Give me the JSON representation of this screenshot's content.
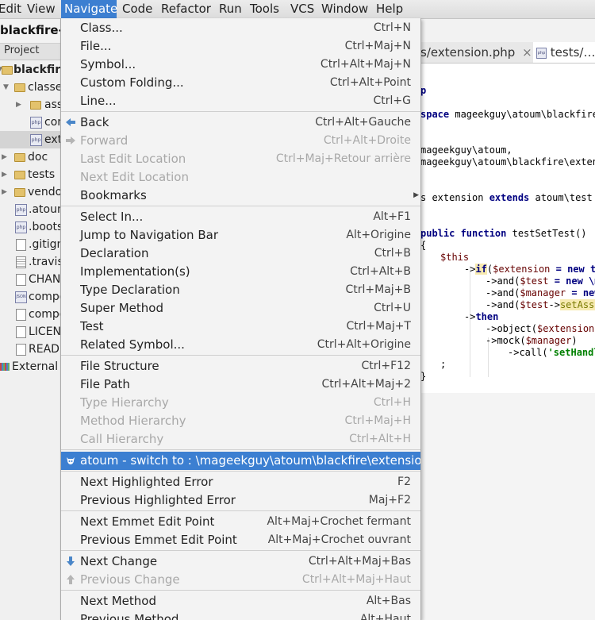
{
  "menubar": [
    "Edit",
    "View",
    "Navigate",
    "Code",
    "Refactor",
    "Run",
    "Tools",
    "VCS",
    "Window",
    "Help"
  ],
  "project_title": "blackfire-extension",
  "panel_header": "Project",
  "tree": [
    {
      "label": "blackfire",
      "icon": "folder-icon"
    },
    {
      "label": "classes",
      "icon": "folder-icon"
    },
    {
      "label": "assets",
      "icon": "folder-icon"
    },
    {
      "label": "configuration",
      "icon": "php-file-icon"
    },
    {
      "label": "extension",
      "icon": "php-file-icon"
    },
    {
      "label": "doc",
      "icon": "folder-icon"
    },
    {
      "label": "tests",
      "icon": "folder-icon"
    },
    {
      "label": "vendor",
      "icon": "folder-icon"
    },
    {
      "label": ".atoum",
      "icon": "php-file-icon"
    },
    {
      "label": ".bootstrap",
      "icon": "php-file-icon"
    },
    {
      "label": ".gitignore",
      "icon": "file-icon"
    },
    {
      "label": ".travis",
      "icon": "config-file-icon"
    },
    {
      "label": "CHANGELOG",
      "icon": "file-icon"
    },
    {
      "label": "composer",
      "icon": "json-file-icon"
    },
    {
      "label": "composer",
      "icon": "file-icon"
    },
    {
      "label": "LICENSE",
      "icon": "file-icon"
    },
    {
      "label": "README",
      "icon": "file-icon"
    },
    {
      "label": "External Libraries",
      "icon": "libraries-icon"
    }
  ],
  "tabs": [
    {
      "label": "s/extension.php",
      "close": "×"
    },
    {
      "label": "tests/…/"
    }
  ],
  "code": {
    "l1": "p",
    "l2a": "space ",
    "l2b": "mageekguy\\atoum\\blackfire\\",
    "l3": "mageekguy\\atoum,",
    "l4": "mageekguy\\atoum\\blackfire\\extens",
    "l5a": "s extension ",
    "l5b": "extends ",
    "l5c": "atoum\\test",
    "l6a": "public function ",
    "l6b": "testSetTest()",
    "l7": "{",
    "l8": "$this",
    "l9a": "->",
    "l9b": "if",
    "l9c": "(",
    "l9d": "$extension",
    " l9e": "",
    "l9f": " = new te",
    "l10a": "->and(",
    "l10b": "$test",
    " l10c": "",
    "l10d": " = new \\m",
    "l11a": "->and(",
    "l11b": "$manager",
    "l11c": " = new",
    "l12a": "->and(",
    "l12b": "$test",
    "l12c": "->",
    "l12d": "setAsse",
    "l13a": "->",
    "l13b": "then",
    "l14a": "->object(",
    "l14b": "$extension",
    "l14c": "-",
    "l15a": "->mock(",
    "l15b": "$manager",
    "l15c": ")",
    "l16a": "->call(",
    "l16b": "'setHandl",
    "l17": ";",
    "l18": "}"
  },
  "menu": [
    {
      "label": "Class...",
      "shortcut": "Ctrl+N"
    },
    {
      "label": "File...",
      "shortcut": "Ctrl+Maj+N"
    },
    {
      "label": "Symbol...",
      "shortcut": "Ctrl+Alt+Maj+N"
    },
    {
      "label": "Custom Folding...",
      "shortcut": "Ctrl+Alt+Point"
    },
    {
      "label": "Line...",
      "shortcut": "Ctrl+G"
    },
    {
      "label": "Back",
      "shortcut": "Ctrl+Alt+Gauche",
      "icon": "back-arrow-icon"
    },
    {
      "label": "Forward",
      "shortcut": "Ctrl+Alt+Droite",
      "icon": "forward-arrow-icon",
      "disabled": true
    },
    {
      "label": "Last Edit Location",
      "shortcut": "Ctrl+Maj+Retour arrière",
      "disabled": true
    },
    {
      "label": "Next Edit Location",
      "shortcut": "",
      "disabled": true
    },
    {
      "label": "Bookmarks",
      "shortcut": "",
      "submenu": true
    },
    {
      "label": "Select In...",
      "shortcut": "Alt+F1"
    },
    {
      "label": "Jump to Navigation Bar",
      "shortcut": "Alt+Origine"
    },
    {
      "label": "Declaration",
      "shortcut": "Ctrl+B"
    },
    {
      "label": "Implementation(s)",
      "shortcut": "Ctrl+Alt+B"
    },
    {
      "label": "Type Declaration",
      "shortcut": "Ctrl+Maj+B"
    },
    {
      "label": "Super Method",
      "shortcut": "Ctrl+U"
    },
    {
      "label": "Test",
      "shortcut": "Ctrl+Maj+T"
    },
    {
      "label": "Related Symbol...",
      "shortcut": "Ctrl+Alt+Origine"
    },
    {
      "label": "File Structure",
      "shortcut": "Ctrl+F12"
    },
    {
      "label": "File Path",
      "shortcut": "Ctrl+Alt+Maj+2"
    },
    {
      "label": "Type Hierarchy",
      "shortcut": "Ctrl+H",
      "disabled": true
    },
    {
      "label": "Method Hierarchy",
      "shortcut": "Ctrl+Maj+H",
      "disabled": true
    },
    {
      "label": "Call Hierarchy",
      "shortcut": "Ctrl+Alt+H",
      "disabled": true
    },
    {
      "label": "atoum - switch to : \\mageekguy\\atoum\\blackfire\\extension",
      "shortcut": "",
      "icon": "atoum-icon",
      "highlighted": true
    },
    {
      "label": "Next Highlighted Error",
      "shortcut": "F2"
    },
    {
      "label": "Previous Highlighted Error",
      "shortcut": "Maj+F2"
    },
    {
      "label": "Next Emmet Edit Point",
      "shortcut": "Alt+Maj+Crochet fermant"
    },
    {
      "label": "Previous Emmet Edit Point",
      "shortcut": "Alt+Maj+Crochet ouvrant"
    },
    {
      "label": "Next Change",
      "shortcut": "Ctrl+Alt+Maj+Bas",
      "icon": "down-arrow-icon"
    },
    {
      "label": "Previous Change",
      "shortcut": "Ctrl+Alt+Maj+Haut",
      "icon": "up-arrow-icon",
      "disabled": true
    },
    {
      "label": "Next Method",
      "shortcut": "Alt+Bas"
    },
    {
      "label": "Previous Method",
      "shortcut": "Alt+Haut"
    }
  ]
}
